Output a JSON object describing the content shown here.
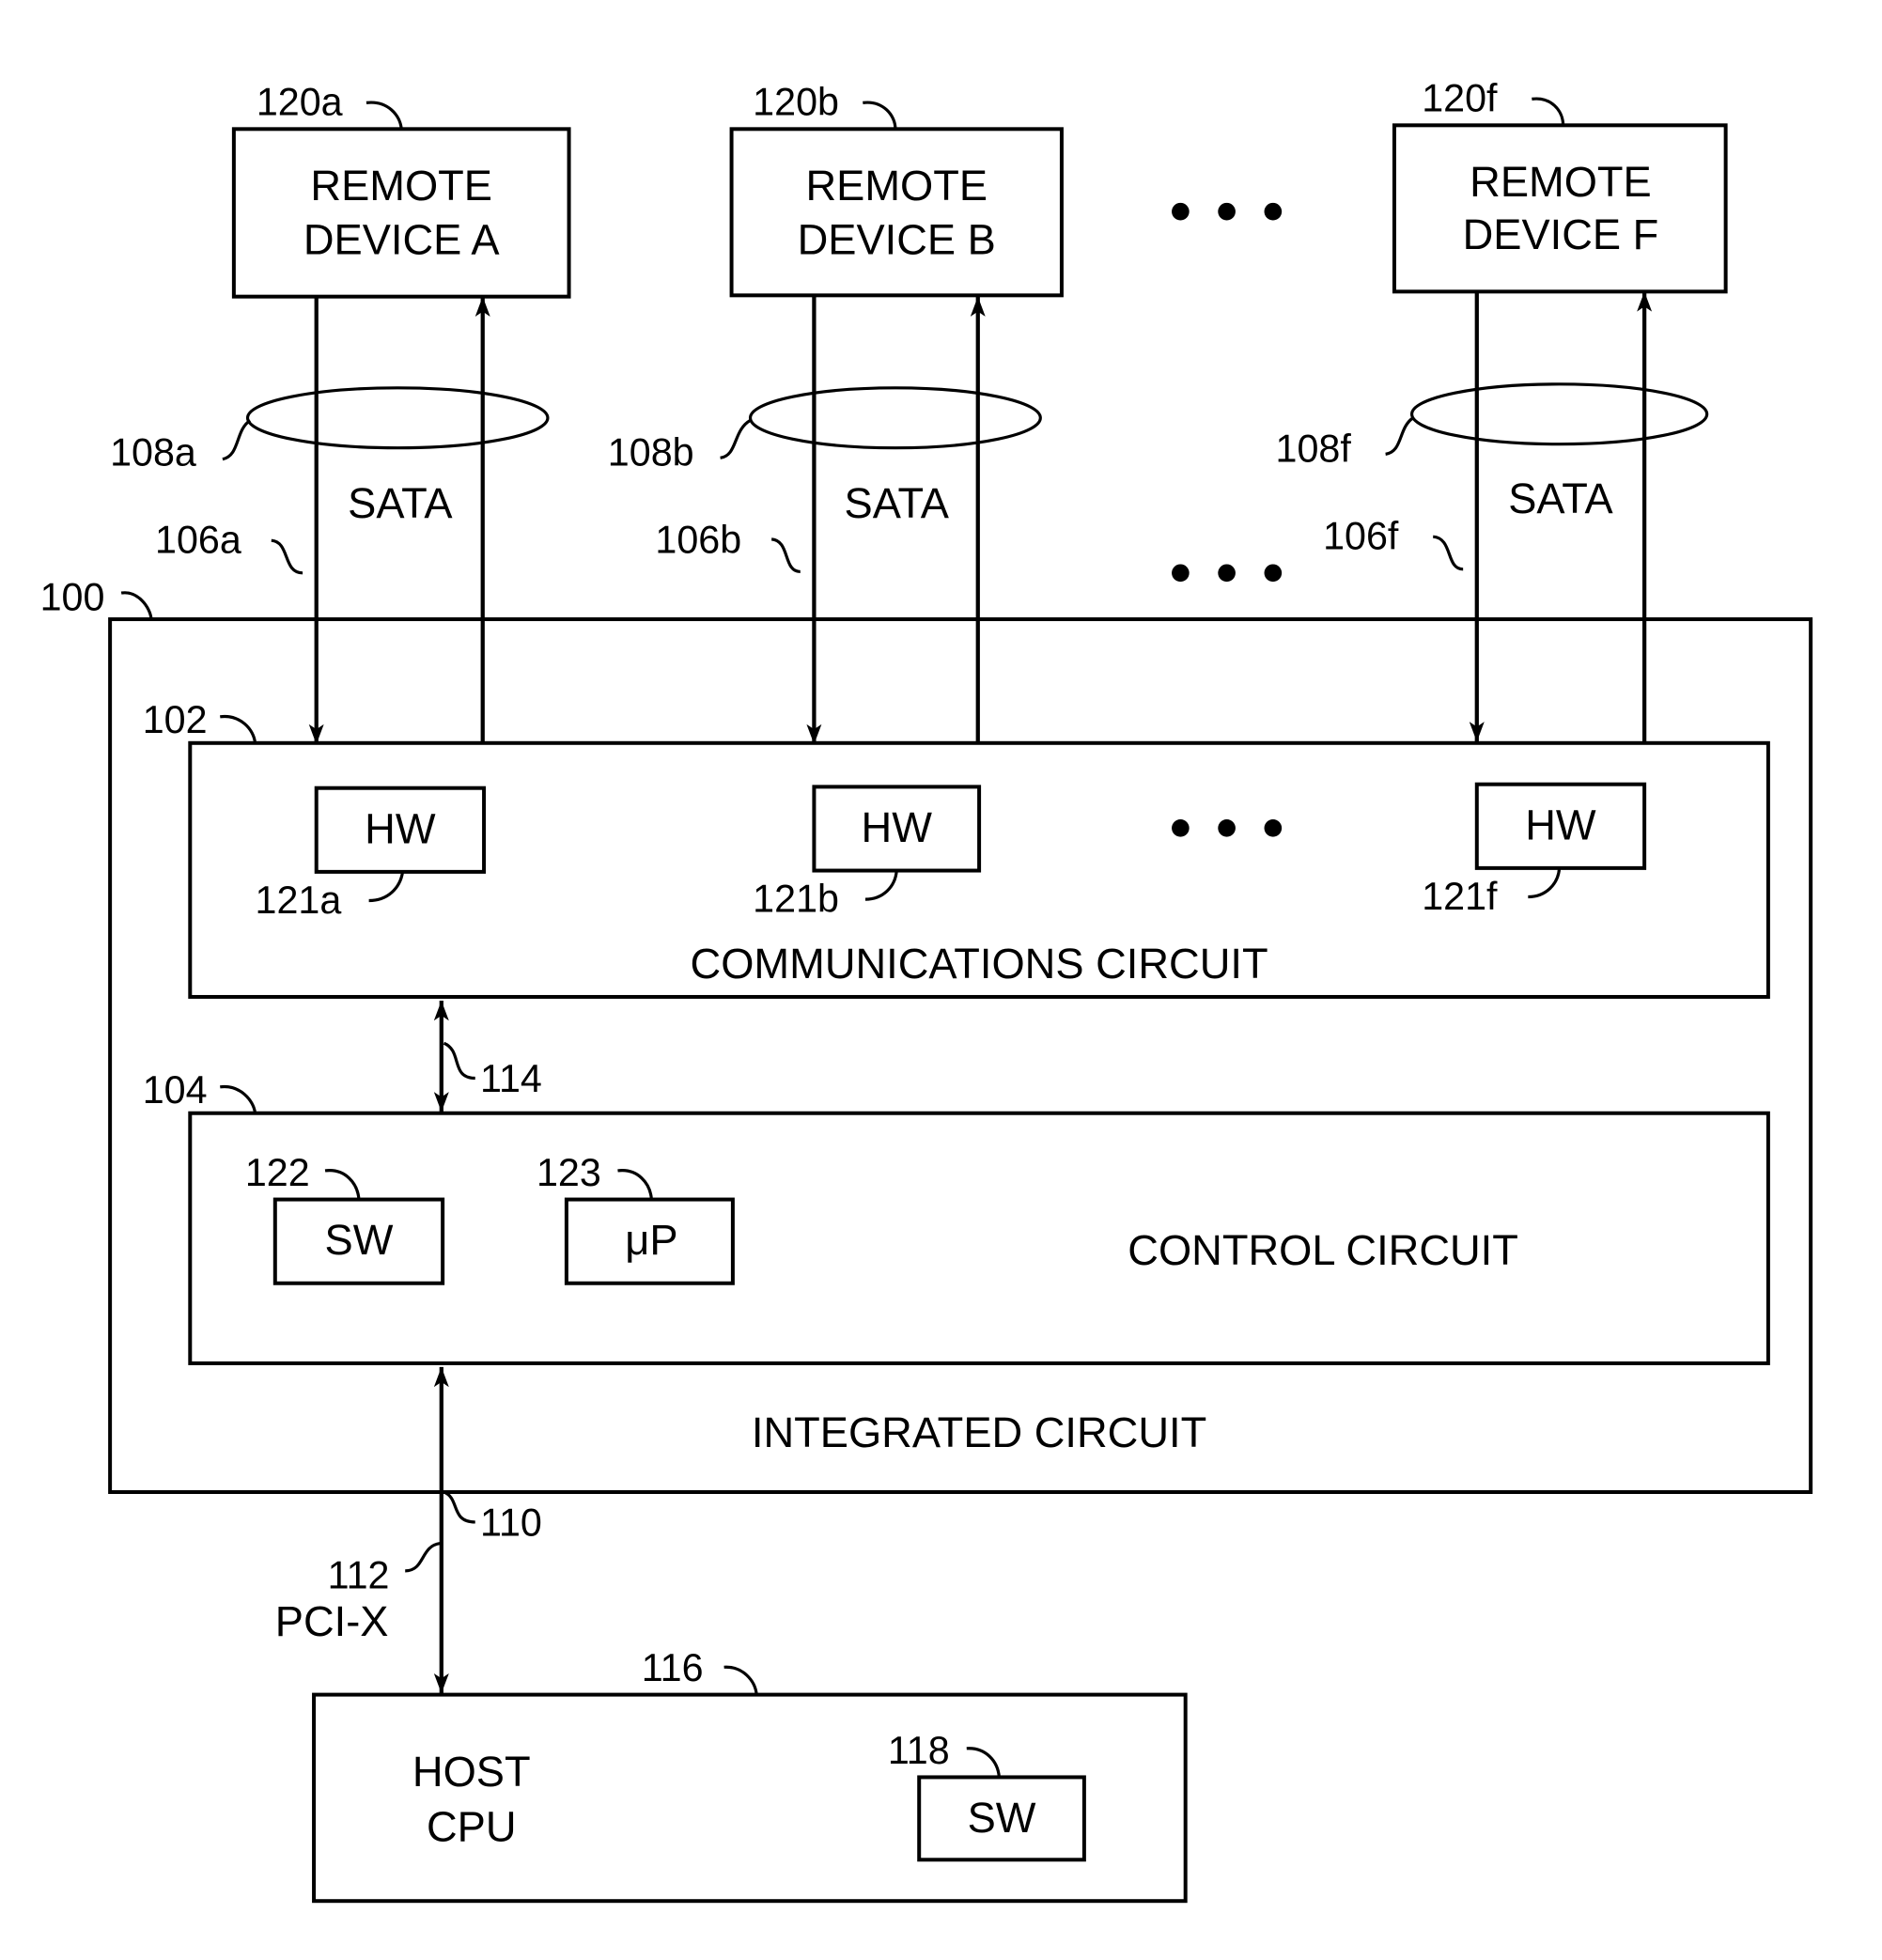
{
  "figure": {
    "remote_devices": [
      {
        "ref": "120a",
        "line1": "REMOTE",
        "line2": "DEVICE A",
        "link_ref": "108a",
        "bus_ref": "106a",
        "protocol": "SATA"
      },
      {
        "ref": "120b",
        "line1": "REMOTE",
        "line2": "DEVICE B",
        "link_ref": "108b",
        "bus_ref": "106b",
        "protocol": "SATA"
      },
      {
        "ref": "120f",
        "line1": "REMOTE",
        "line2": "DEVICE F",
        "link_ref": "108f",
        "bus_ref": "106f",
        "protocol": "SATA"
      }
    ],
    "integrated_circuit": {
      "ref": "100",
      "label": "INTEGRATED CIRCUIT"
    },
    "communications_circuit": {
      "ref": "102",
      "label": "COMMUNICATIONS CIRCUIT",
      "hw_blocks": [
        {
          "ref": "121a",
          "label": "HW"
        },
        {
          "ref": "121b",
          "label": "HW"
        },
        {
          "ref": "121f",
          "label": "HW"
        }
      ]
    },
    "internal_bus": {
      "ref": "114"
    },
    "control_circuit": {
      "ref": "104",
      "label": "CONTROL CIRCUIT",
      "sw": {
        "ref": "122",
        "label": "SW"
      },
      "up": {
        "ref": "123",
        "label": "μP"
      }
    },
    "host_bus": {
      "ref": "110",
      "bus_ref": "112",
      "protocol": "PCI-X"
    },
    "host_cpu": {
      "ref": "116",
      "line1": "HOST",
      "line2": "CPU",
      "sw": {
        "ref": "118",
        "label": "SW"
      }
    },
    "ellipsis": "• • •"
  }
}
